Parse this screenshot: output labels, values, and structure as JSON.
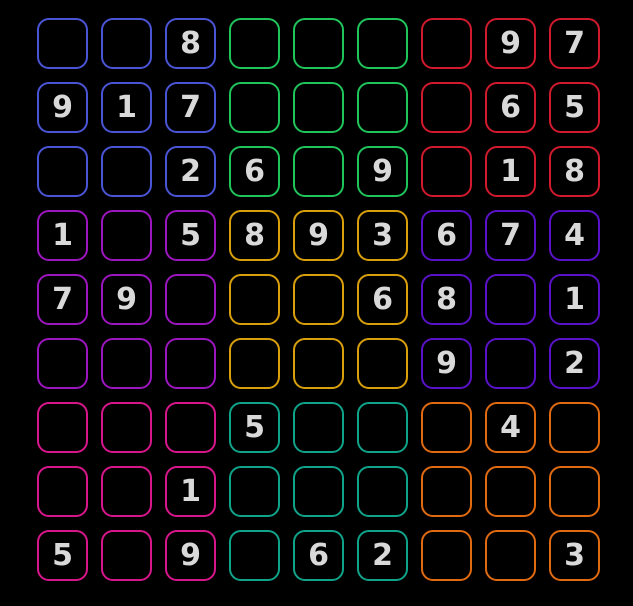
{
  "puzzle": {
    "grid": [
      [
        "",
        "",
        "8",
        "",
        "",
        "",
        "",
        "9",
        "7"
      ],
      [
        "9",
        "1",
        "7",
        "",
        "",
        "",
        "",
        "6",
        "5"
      ],
      [
        "",
        "",
        "2",
        "6",
        "",
        "9",
        "",
        "1",
        "8"
      ],
      [
        "1",
        "",
        "5",
        "8",
        "9",
        "3",
        "6",
        "7",
        "4"
      ],
      [
        "7",
        "9",
        "",
        "",
        "",
        "6",
        "8",
        "",
        "1"
      ],
      [
        "",
        "",
        "",
        "",
        "",
        "",
        "9",
        "",
        "2"
      ],
      [
        "",
        "",
        "",
        "5",
        "",
        "",
        "",
        "4",
        ""
      ],
      [
        "",
        "",
        "1",
        "",
        "",
        "",
        "",
        "",
        ""
      ],
      [
        "5",
        "",
        "9",
        "",
        "6",
        "2",
        "",
        "",
        "3"
      ]
    ],
    "box_colors": [
      [
        "#4a55d6",
        "#1fc45a",
        "#d11a2e"
      ],
      [
        "#9c16bf",
        "#d9a00c",
        "#5a12c9"
      ],
      [
        "#d8168c",
        "#0fa38a",
        "#e06a10"
      ]
    ]
  }
}
